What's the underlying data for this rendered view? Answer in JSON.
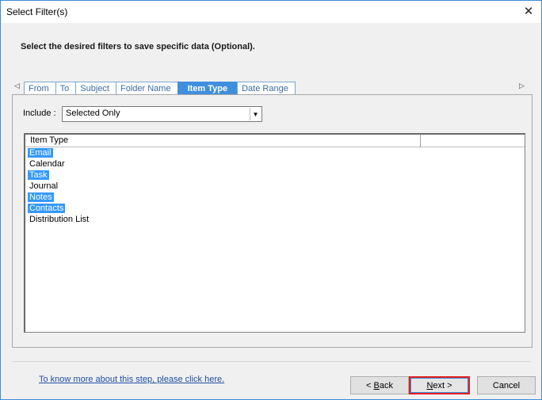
{
  "window": {
    "title": "Select Filter(s)",
    "close_icon": "close-icon"
  },
  "instruction": "Select the desired filters to save specific data (Optional).",
  "tabs": [
    {
      "label": "From",
      "active": false
    },
    {
      "label": "To",
      "active": false
    },
    {
      "label": "Subject",
      "active": false
    },
    {
      "label": "Folder Name",
      "active": false
    },
    {
      "label": "Item Type",
      "active": true
    },
    {
      "label": "Date Range",
      "active": false
    }
  ],
  "include": {
    "label": "Include :",
    "value": "Selected Only"
  },
  "listview": {
    "column_header": "Item Type",
    "items": [
      {
        "label": "Email",
        "selected": true
      },
      {
        "label": "Calendar",
        "selected": false
      },
      {
        "label": "Task",
        "selected": true
      },
      {
        "label": "Journal",
        "selected": false
      },
      {
        "label": "Notes",
        "selected": true
      },
      {
        "label": "Contacts",
        "selected": true
      },
      {
        "label": "Distribution List",
        "selected": false
      }
    ]
  },
  "footer": {
    "help_link": "To know more about this step, please click here.",
    "back_prefix": "< ",
    "back_accel": "B",
    "back_rest": "ack",
    "next_accel": "N",
    "next_rest": "ext >",
    "cancel_label": "Cancel"
  },
  "colors": {
    "accent": "#3f8fdf",
    "selection": "#3399ff",
    "highlight_border": "#e02020",
    "link": "#1f4fa3"
  }
}
